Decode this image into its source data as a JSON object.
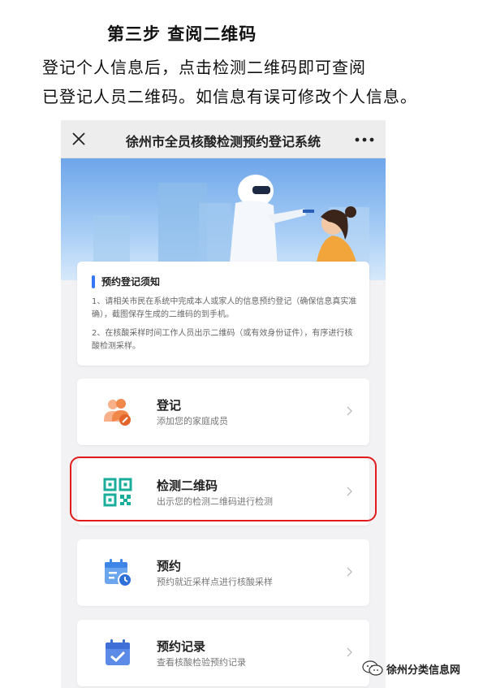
{
  "doc": {
    "step_title": "第三步 查阅二维码",
    "line1": "登记个人信息后，点击检测二维码即可查阅",
    "line2": "已登记人员二维码。如信息有误可修改个人信息。"
  },
  "app": {
    "title": "徐州市全员核酸检测预约登记系统",
    "close_icon": "close-icon",
    "more_icon": "more-icon"
  },
  "notice": {
    "title": "预约登记须知",
    "p1": "1、请相关市民在系统中完成本人或家人的信息预约登记（确保信息真实准确），截图保存生成的二维码的到手机。",
    "p2": "2、在核酸采样时间工作人员出示二维码（或有效身份证件），有序进行核酸检测采样。"
  },
  "menu": [
    {
      "title": "登记",
      "subtitle": "添加您的家庭成员",
      "icon": "family-add-icon"
    },
    {
      "title": "检测二维码",
      "subtitle": "出示您的检测二维码进行检测",
      "icon": "qr-code-icon"
    },
    {
      "title": "预约",
      "subtitle": "预约就近采样点进行核酸采样",
      "icon": "calendar-clock-icon"
    },
    {
      "title": "预约记录",
      "subtitle": "查看核酸检验预约记录",
      "icon": "calendar-check-icon"
    }
  ],
  "colors": {
    "accent": "#3478f6",
    "highlight": "#e21b1b",
    "qr": "#1aad9b",
    "orange": "#f0884a"
  },
  "watermark": {
    "text": "徐州分类信息网",
    "icon": "wechat-icon"
  }
}
